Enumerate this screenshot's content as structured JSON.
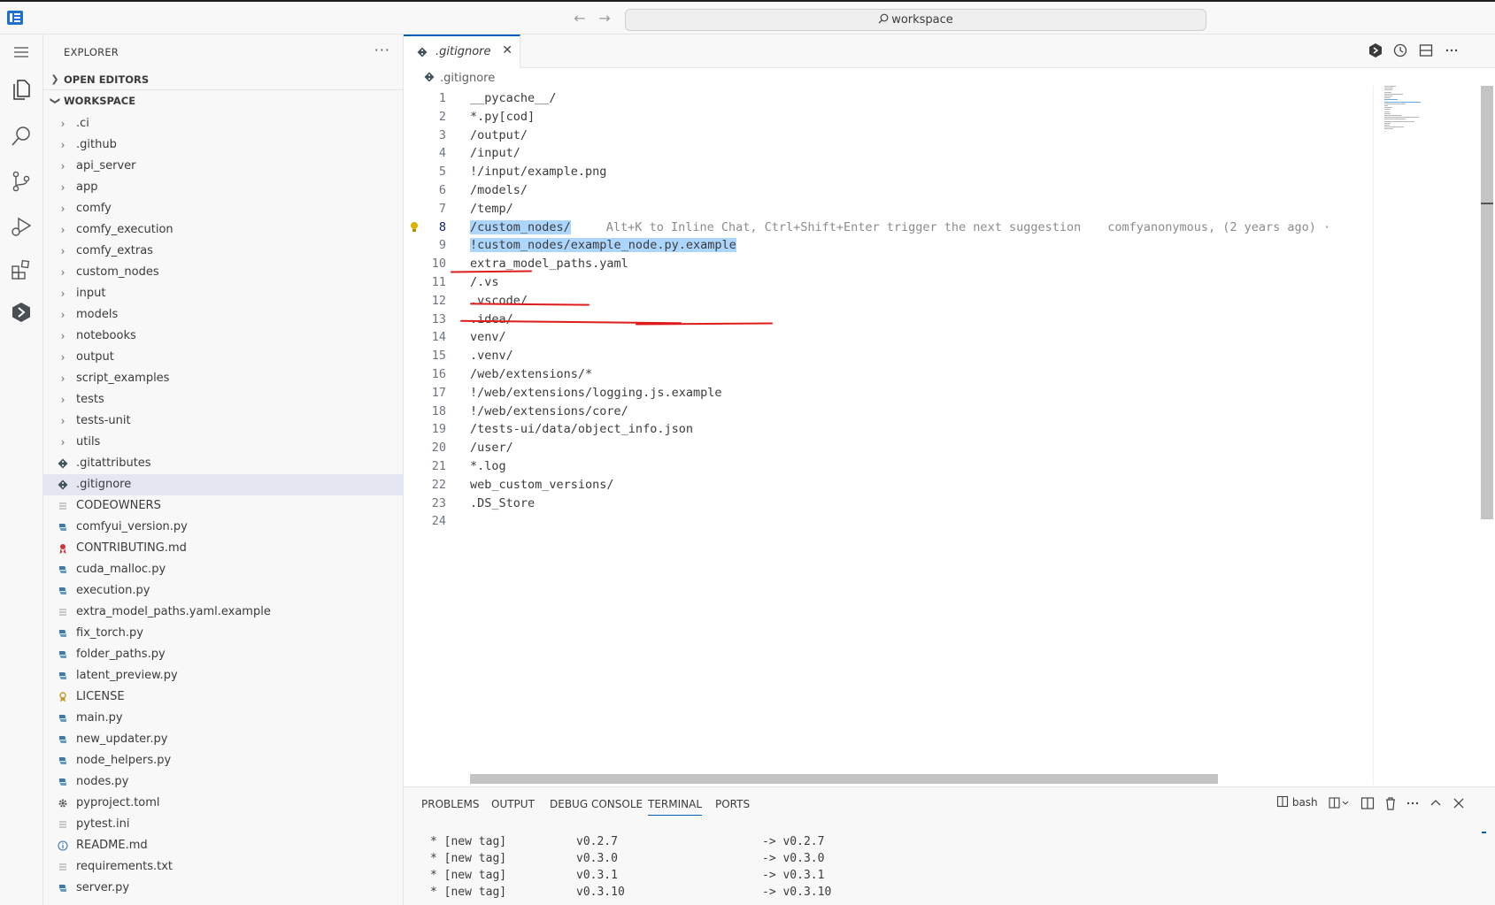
{
  "titlebar": {
    "search_text": "workspace"
  },
  "explorer": {
    "title": "EXPLORER",
    "more": "···",
    "open_editors": "OPEN EDITORS",
    "workspace": "WORKSPACE",
    "items": [
      {
        "name": ".ci",
        "kind": "folder"
      },
      {
        "name": ".github",
        "kind": "folder"
      },
      {
        "name": "api_server",
        "kind": "folder"
      },
      {
        "name": "app",
        "kind": "folder"
      },
      {
        "name": "comfy",
        "kind": "folder"
      },
      {
        "name": "comfy_execution",
        "kind": "folder"
      },
      {
        "name": "comfy_extras",
        "kind": "folder"
      },
      {
        "name": "custom_nodes",
        "kind": "folder"
      },
      {
        "name": "input",
        "kind": "folder"
      },
      {
        "name": "models",
        "kind": "folder"
      },
      {
        "name": "notebooks",
        "kind": "folder"
      },
      {
        "name": "output",
        "kind": "folder"
      },
      {
        "name": "script_examples",
        "kind": "folder"
      },
      {
        "name": "tests",
        "kind": "folder"
      },
      {
        "name": "tests-unit",
        "kind": "folder"
      },
      {
        "name": "utils",
        "kind": "folder"
      },
      {
        "name": ".gitattributes",
        "kind": "git"
      },
      {
        "name": ".gitignore",
        "kind": "git",
        "selected": true
      },
      {
        "name": "CODEOWNERS",
        "kind": "text"
      },
      {
        "name": "comfyui_version.py",
        "kind": "python"
      },
      {
        "name": "CONTRIBUTING.md",
        "kind": "contrib"
      },
      {
        "name": "cuda_malloc.py",
        "kind": "python"
      },
      {
        "name": "execution.py",
        "kind": "python"
      },
      {
        "name": "extra_model_paths.yaml.example",
        "kind": "text"
      },
      {
        "name": "fix_torch.py",
        "kind": "python"
      },
      {
        "name": "folder_paths.py",
        "kind": "python"
      },
      {
        "name": "latent_preview.py",
        "kind": "python"
      },
      {
        "name": "LICENSE",
        "kind": "license"
      },
      {
        "name": "main.py",
        "kind": "python"
      },
      {
        "name": "new_updater.py",
        "kind": "python"
      },
      {
        "name": "node_helpers.py",
        "kind": "python"
      },
      {
        "name": "nodes.py",
        "kind": "python"
      },
      {
        "name": "pyproject.toml",
        "kind": "gear"
      },
      {
        "name": "pytest.ini",
        "kind": "text"
      },
      {
        "name": "README.md",
        "kind": "info"
      },
      {
        "name": "requirements.txt",
        "kind": "text"
      },
      {
        "name": "server.py",
        "kind": "python"
      }
    ]
  },
  "editor": {
    "tab_label": ".gitignore",
    "tab_close": "✕",
    "breadcrumb": ".gitignore",
    "current_line": 8,
    "lines": [
      {
        "n": "1",
        "text": "__pycache__/"
      },
      {
        "n": "2",
        "text": "*.py[cod]"
      },
      {
        "n": "3",
        "text": "/output/"
      },
      {
        "n": "4",
        "text": "/input/"
      },
      {
        "n": "5",
        "text": "!/input/example.png"
      },
      {
        "n": "6",
        "text": "/models/"
      },
      {
        "n": "7",
        "text": "/temp/"
      },
      {
        "n": "8",
        "text": "/custom_nodes/",
        "selected": true,
        "ghost": "Alt+K to Inline Chat, Ctrl+Shift+Enter trigger the next suggestion",
        "blame": "comfyanonymous, (2 years ago) ·"
      },
      {
        "n": "9",
        "text": "!custom_nodes/example_node.py.example",
        "selected": true
      },
      {
        "n": "10",
        "text": "extra_model_paths.yaml"
      },
      {
        "n": "11",
        "text": "/.vs"
      },
      {
        "n": "12",
        "text": ".vscode/"
      },
      {
        "n": "13",
        "text": ".idea/"
      },
      {
        "n": "14",
        "text": "venv/"
      },
      {
        "n": "15",
        "text": ".venv/"
      },
      {
        "n": "16",
        "text": "/web/extensions/*"
      },
      {
        "n": "17",
        "text": "!/web/extensions/logging.js.example"
      },
      {
        "n": "18",
        "text": "!/web/extensions/core/"
      },
      {
        "n": "19",
        "text": "/tests-ui/data/object_info.json"
      },
      {
        "n": "20",
        "text": "/user/"
      },
      {
        "n": "21",
        "text": "*.log"
      },
      {
        "n": "22",
        "text": "web_custom_versions/"
      },
      {
        "n": "23",
        "text": ".DS_Store"
      },
      {
        "n": "24",
        "text": ""
      }
    ]
  },
  "panel": {
    "tabs": [
      "PROBLEMS",
      "OUTPUT",
      "DEBUG CONSOLE",
      "TERMINAL",
      "PORTS"
    ],
    "active_tab": "TERMINAL",
    "shell": "bash",
    "terminal_lines": [
      {
        "a": "* [new tag]",
        "b": "v0.2.7",
        "c": "-> v0.2.7"
      },
      {
        "a": "* [new tag]",
        "b": "v0.3.0",
        "c": "-> v0.3.0"
      },
      {
        "a": "* [new tag]",
        "b": "v0.3.1",
        "c": "-> v0.3.1"
      },
      {
        "a": "* [new tag]",
        "b": "v0.3.10",
        "c": "-> v0.3.10"
      }
    ]
  },
  "colors": {
    "accent": "#005fb8",
    "selection": "#add6ff",
    "annotation": "#e01b1b",
    "python_icon": "#3c78aa",
    "git_icon": "#41535b"
  }
}
